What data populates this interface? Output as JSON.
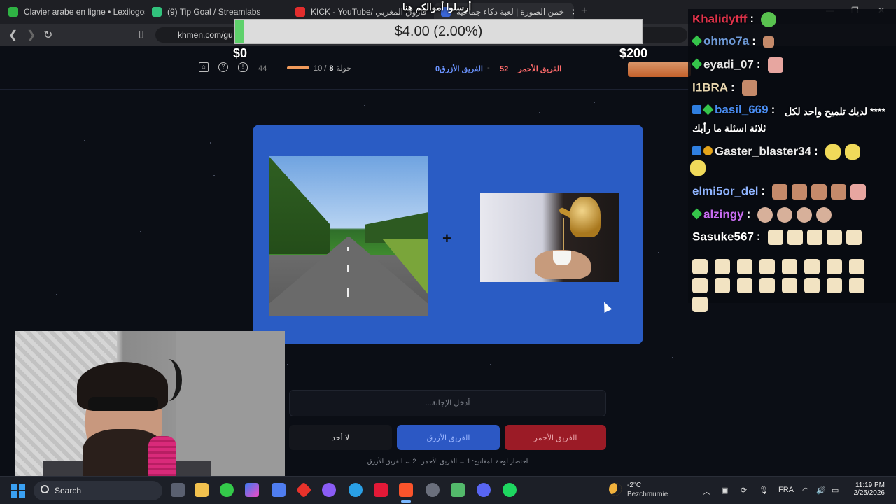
{
  "browser": {
    "tabs": [
      {
        "label": "Clavier arabe en ligne • Lexilogos",
        "color": "#2fb344"
      },
      {
        "label": "(9) Tip Goal / Streamlabs",
        "color": "#31c27c"
      },
      {
        "label": "KICK - YouTube/ فاروق المغربي",
        "color": "#e22d2d"
      },
      {
        "label": "خمن الصورة | لعبة ذكاء جماعية",
        "color": "#3a66d6"
      }
    ],
    "url": "khmen.com/gu"
  },
  "stream": {
    "banner": "أرسلوا أموالكم هنا",
    "goal": {
      "text": "$4.00 (2.00%)",
      "min": "$0",
      "max": "$200",
      "fraction": 0.02
    }
  },
  "game": {
    "score_total": "44",
    "round_label": "جولة",
    "round_current": "8",
    "round_total": "10",
    "blue_team_label": "الفريق الأزرق",
    "blue_score": "0",
    "red_team_label": "الفريق الأحمر",
    "red_score": "52",
    "answer_placeholder": "أدخل الإجابة...",
    "buttons": {
      "none": "لا أحد",
      "blue": "الفريق الأزرق",
      "red": "الفريق الأحمر"
    },
    "shortcuts": "اختصار لوحة المفاتيح: 1 ← الفريق الأحمر ، 2 ← الفريق الأزرق",
    "plus": "+"
  },
  "chat": {
    "messages": [
      {
        "user": "Khalidytff",
        "color": "#e0334b"
      },
      {
        "user": "ohmo7a",
        "color": "#6f9bd9"
      },
      {
        "user": "eyadi_07",
        "color": "#e8e8e8"
      },
      {
        "user": "I1BRA",
        "color": "#e8d7b0"
      },
      {
        "user": "basil_669",
        "color": "#4a8df2",
        "text1": "لديك تلميح واحد لكل ****",
        "text2": "ثلاثة اسئلة ما رأيك"
      },
      {
        "user": "Gaster_blaster34",
        "color": "#e9e9e9"
      },
      {
        "user": "elmi5or_del",
        "color": "#8fb4ff"
      },
      {
        "user": "alzingy",
        "color": "#c76cf0"
      },
      {
        "user": "Sasuke567",
        "color": "#ffffff"
      }
    ]
  },
  "taskbar": {
    "search": "Search",
    "temperature": "-2°C",
    "location": "Bezchmurnie",
    "language": "FRA",
    "time": "11:19 PM",
    "date": "2/25/2026"
  }
}
